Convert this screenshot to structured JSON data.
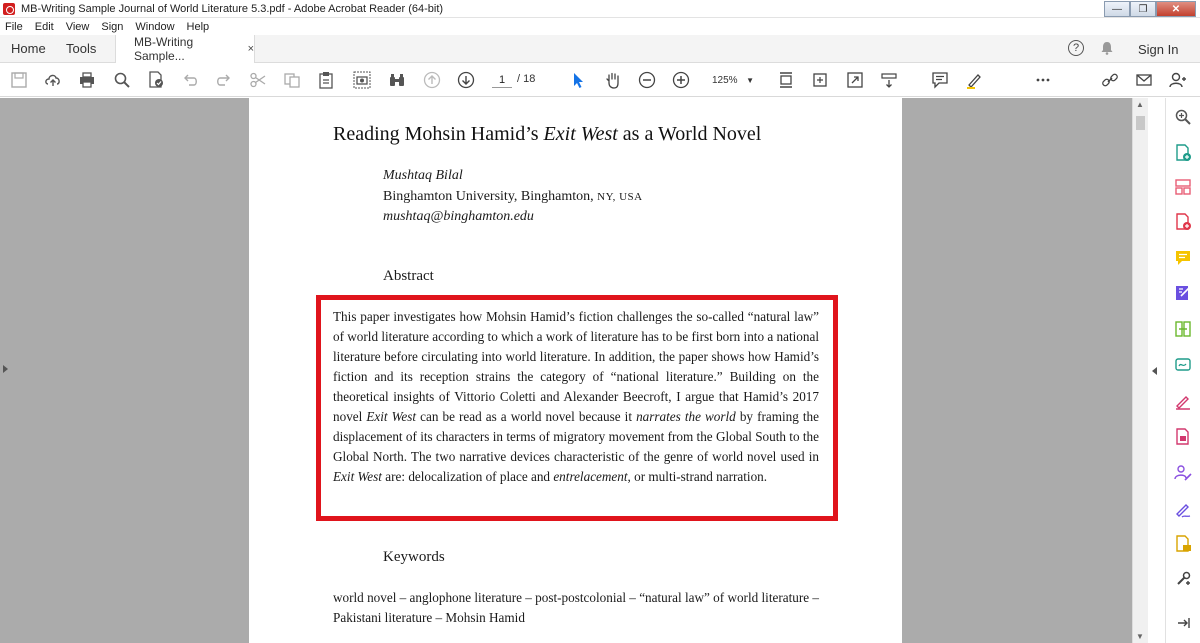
{
  "window": {
    "title": "MB-Writing Sample Journal of World Literature 5.3.pdf - Adobe Acrobat Reader (64-bit)",
    "minimize": "—",
    "maximize": "❐",
    "close": "✕"
  },
  "menu": [
    "File",
    "Edit",
    "View",
    "Sign",
    "Window",
    "Help"
  ],
  "tabs": {
    "home": "Home",
    "tools": "Tools",
    "document": "MB-Writing Sample...",
    "close": "×"
  },
  "header_right": {
    "help": "?",
    "sign_in": "Sign In"
  },
  "toolbar": {
    "page_current": "1",
    "page_total": "/ 18",
    "zoom": "125%",
    "zoom_chevron": "▼"
  },
  "document": {
    "title_pre": "Reading Mohsin Hamid’s ",
    "title_italic": "Exit West",
    "title_post": " as a World Novel",
    "author": "Mushtaq Bilal",
    "affiliation": "Binghamton University, Binghamton, ",
    "affiliation_sc": "NY, USA",
    "email": "mushtaq@binghamton.edu",
    "abstract_heading": "Abstract",
    "abstract_parts": {
      "p1": "This paper investigates how Mohsin Hamid’s fiction challenges the so-called “natural law” of world literature according to which a work of literature has to be first born into a national literature before circulating into world literature. In addition, the paper shows how Hamid’s fiction and its reception strains the category of “national literature.” Building on the theoretical insights of Vittorio Coletti and Alexander Beecroft, I argue that Hamid’s 2017 novel ",
      "i1": "Exit West",
      "p2": " can be read as a world novel because it ",
      "i2": "narrates the world",
      "p3": " by framing the displacement of its characters in terms of migratory movement from the Global South to the Global North. The two narrative devices characteristic of the genre of world novel used in ",
      "i3": "Exit West",
      "p4": " are: delocalization of place and ",
      "i4": "entrelacement",
      "p5": ", or multi-strand narration."
    },
    "keywords_heading": "Keywords",
    "keywords": "world novel – anglophone literature – post-postcolonial – “natural law” of world literature – Pakistani literature – Mohsin Hamid"
  },
  "colors": {
    "highlight_box": "#e0141c",
    "viewer_background": "#ababab",
    "acrobat_red": "#d21f1f"
  }
}
